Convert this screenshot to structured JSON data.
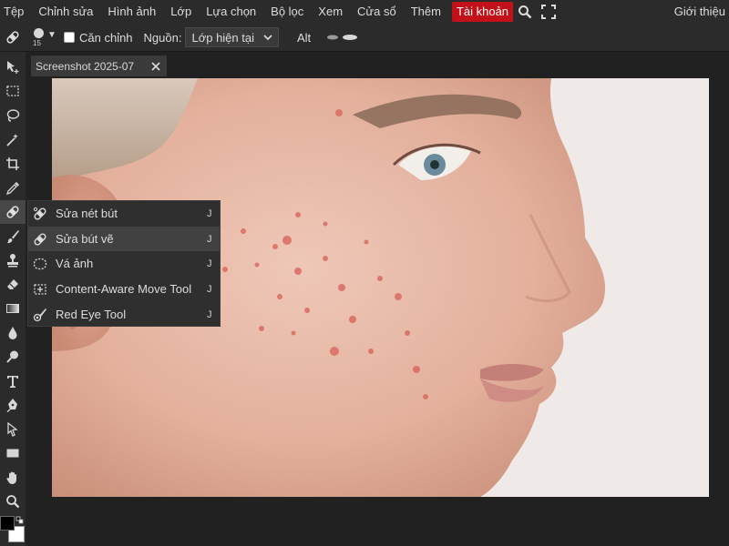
{
  "menu": {
    "items": [
      "Tệp",
      "Chỉnh sửa",
      "Hình ảnh",
      "Lớp",
      "Lựa chọn",
      "Bộ lọc",
      "Xem",
      "Cửa sổ",
      "Thêm"
    ],
    "account": "Tài khoản",
    "about": "Giới thiệu",
    "icons": [
      "search-icon",
      "fullscreen-icon"
    ],
    "account_color": "#c3111a"
  },
  "options": {
    "brush_size": "15",
    "align_label": "Căn chỉnh",
    "source_label": "Nguồn:",
    "source_value": "Lớp hiện tại",
    "alt_label": "Alt"
  },
  "tab": {
    "title": "Screenshot 2025-07"
  },
  "flyout": {
    "items": [
      {
        "label": "Sửa nét bút",
        "key": "J",
        "icon": "spot-healing-icon"
      },
      {
        "label": "Sửa bút vẽ",
        "key": "J",
        "icon": "healing-brush-icon"
      },
      {
        "label": "Vá ảnh",
        "key": "J",
        "icon": "patch-icon"
      },
      {
        "label": "Content-Aware Move Tool",
        "key": "J",
        "icon": "content-aware-move-icon"
      },
      {
        "label": "Red Eye Tool",
        "key": "J",
        "icon": "red-eye-icon"
      }
    ],
    "selected_index": 1
  },
  "tools": [
    "move-icon",
    "marquee-icon",
    "lasso-icon",
    "magic-wand-icon",
    "crop-icon",
    "eyedropper-icon",
    "healing-icon",
    "brush-icon",
    "stamp-icon",
    "eraser-icon",
    "gradient-icon",
    "blur-icon",
    "dodge-icon",
    "type-icon",
    "pen-icon",
    "path-select-icon",
    "shape-icon",
    "hand-icon",
    "zoom-icon"
  ],
  "colors": {
    "foreground": "#000000",
    "background": "#ffffff"
  }
}
